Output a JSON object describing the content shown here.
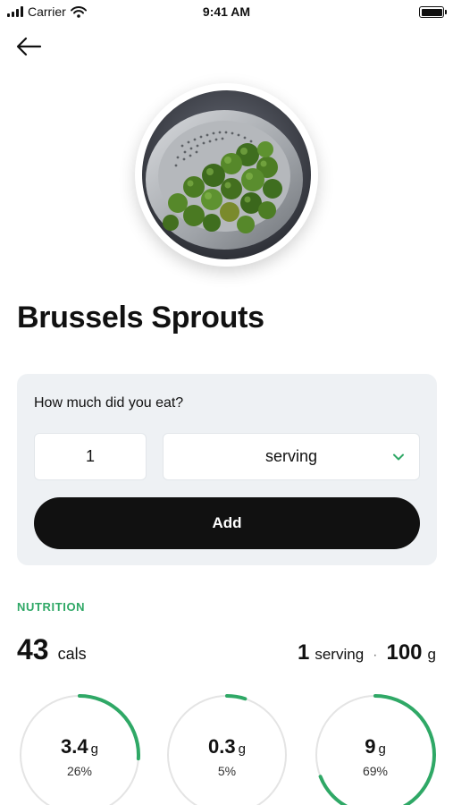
{
  "status_bar": {
    "carrier": "Carrier",
    "time": "9:41 AM",
    "icons": [
      "signal-icon",
      "wifi-icon",
      "battery-icon"
    ]
  },
  "header": {
    "back_icon": "back-arrow-icon"
  },
  "food": {
    "name": "Brussels Sprouts"
  },
  "amount": {
    "question": "How much did you eat?",
    "quantity": "1",
    "unit": "serving",
    "unit_icon": "chevron-down-icon",
    "add_label": "Add"
  },
  "nutrition": {
    "section_label": "NUTRITION",
    "calories": "43",
    "calories_unit": "cals",
    "serving_qty": "1",
    "serving_unit": "serving",
    "separator": "·",
    "weight": "100",
    "weight_unit": "g",
    "macros": [
      {
        "amount": "3.4",
        "unit": "g",
        "percent_label": "26%",
        "fraction": 0.26
      },
      {
        "amount": "0.3",
        "unit": "g",
        "percent_label": "5%",
        "fraction": 0.05
      },
      {
        "amount": "9",
        "unit": "g",
        "percent_label": "69%",
        "fraction": 0.69
      }
    ],
    "ring_color": "#2fa866",
    "track_color": "#e4e4e4"
  },
  "colors": {
    "accent": "#2fa866",
    "button": "#111111",
    "card_bg": "#eef1f4"
  }
}
